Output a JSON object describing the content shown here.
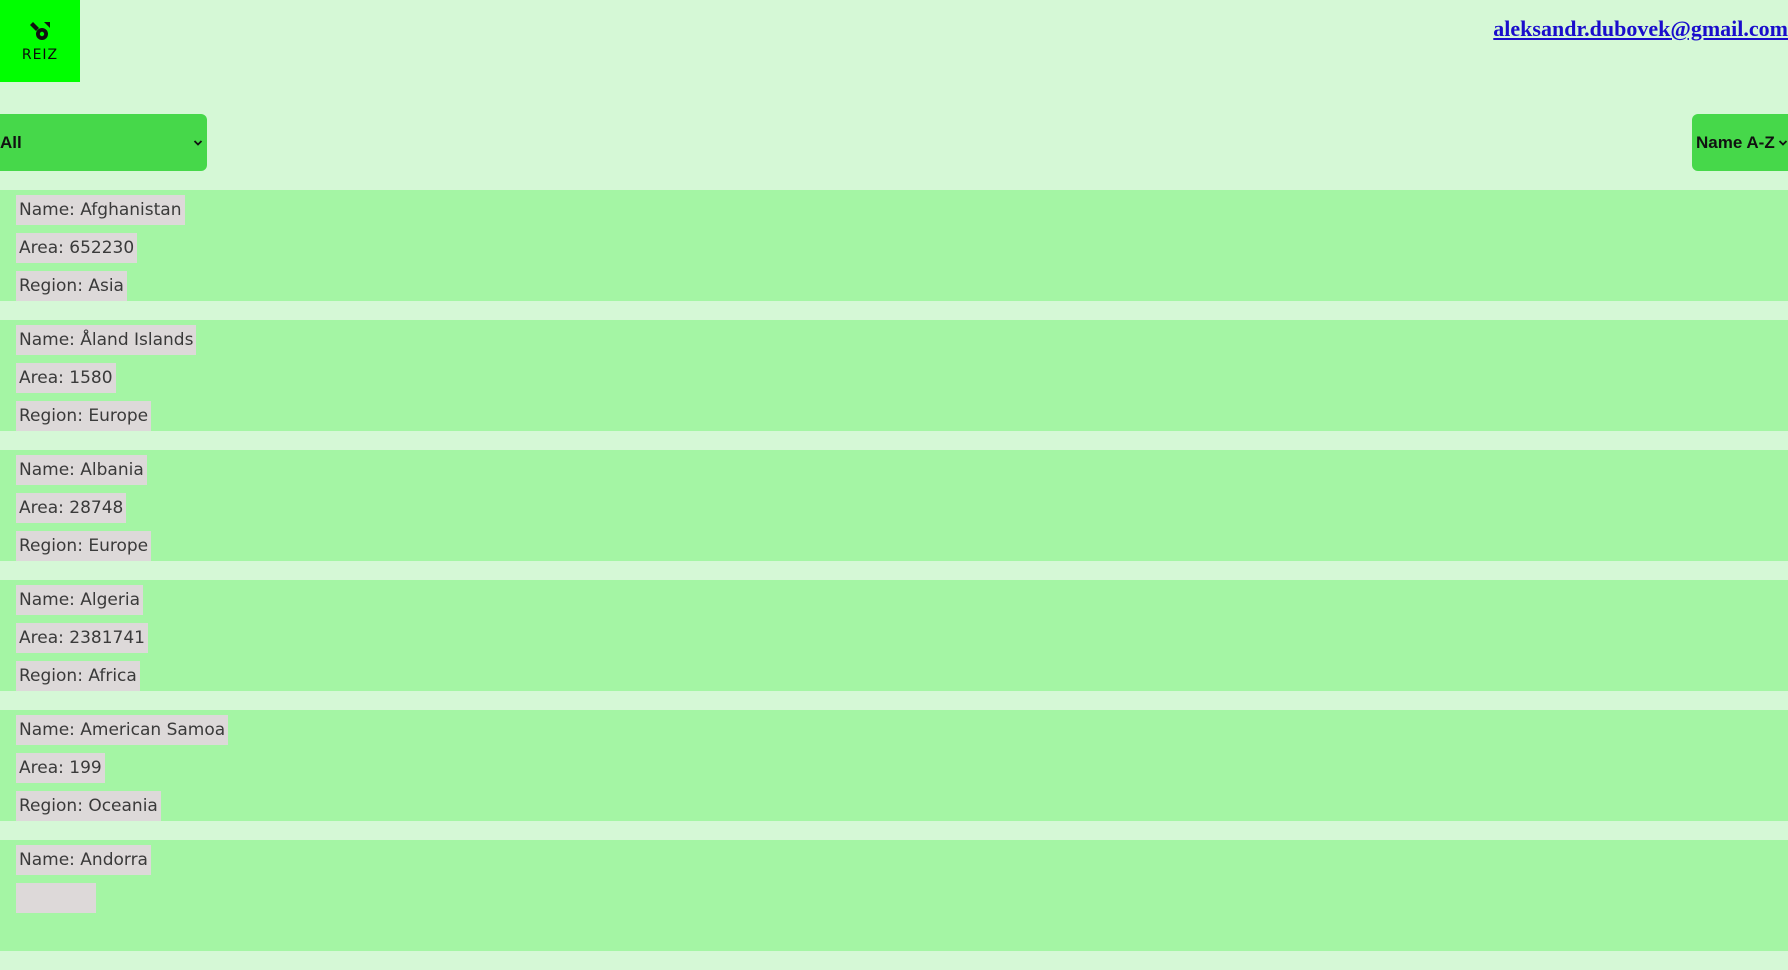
{
  "header": {
    "logo_text": "REIZ",
    "email": "aleksandr.dubovek@gmail.com"
  },
  "filters": {
    "region_selected": "All",
    "sort_selected": "Name A-Z"
  },
  "countries": [
    {
      "name": "Name: Afghanistan",
      "area": "Area: 652230",
      "region": "Region: Asia"
    },
    {
      "name": "Name: Åland Islands",
      "area": "Area: 1580",
      "region": "Region: Europe"
    },
    {
      "name": "Name: Albania",
      "area": "Area: 28748",
      "region": "Region: Europe"
    },
    {
      "name": "Name: Algeria",
      "area": "Area: 2381741",
      "region": "Region: Africa"
    },
    {
      "name": "Name: American Samoa",
      "area": "Area: 199",
      "region": "Region: Oceania"
    },
    {
      "name": "Name: Andorra",
      "area": "",
      "region": ""
    }
  ],
  "colors": {
    "page_bg": "#d5f8d6",
    "card_bg": "#a4f5a4",
    "select_bg": "#46d84a",
    "logo_bg": "#00ff00",
    "field_bg": "#ddd9d9",
    "link": "#1a0dcc"
  }
}
